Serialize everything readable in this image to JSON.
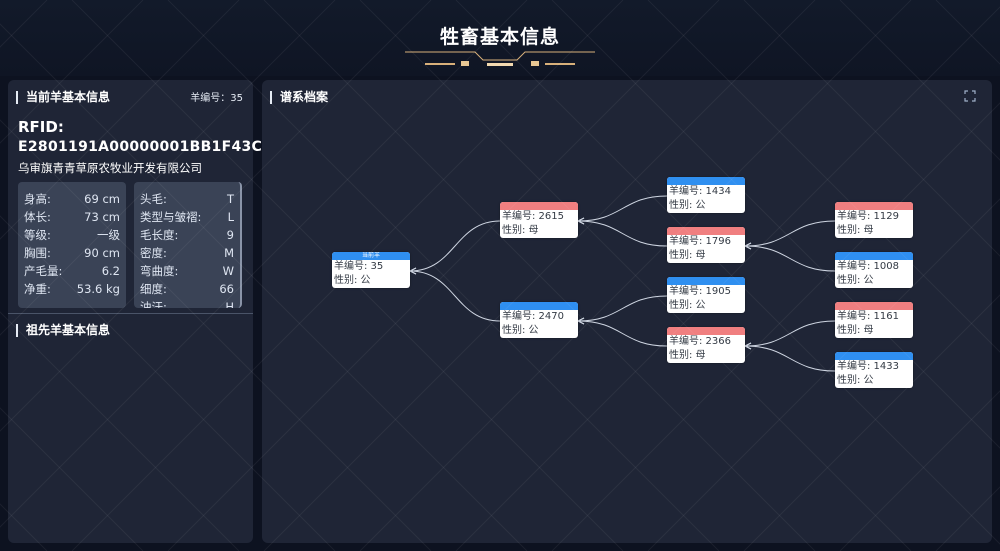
{
  "header": {
    "title": "牲畜基本信息"
  },
  "current_sheep": {
    "panel_title": "当前羊基本信息",
    "sheep_no_label": "羊编号：",
    "sheep_no": "35",
    "rfid_label": "RFID:",
    "rfid_value": "E2801191A00000001BB1F43C",
    "company": "乌审旗青青草原农牧业开发有限公司",
    "attrs_left": [
      {
        "k": "身高:",
        "v": "69 cm"
      },
      {
        "k": "体长:",
        "v": "73 cm"
      },
      {
        "k": "等级:",
        "v": "一级"
      },
      {
        "k": "胸围:",
        "v": "90 cm"
      },
      {
        "k": "产毛量:",
        "v": "6.2"
      },
      {
        "k": "净重:",
        "v": "53.6 kg"
      }
    ],
    "attrs_right": [
      {
        "k": "头毛:",
        "v": "T"
      },
      {
        "k": "类型与皱褶:",
        "v": "L"
      },
      {
        "k": "毛长度:",
        "v": "9"
      },
      {
        "k": "密度:",
        "v": "M"
      },
      {
        "k": "弯曲度:",
        "v": "W"
      },
      {
        "k": "细度:",
        "v": "66"
      },
      {
        "k": "油汗:",
        "v": "H"
      }
    ]
  },
  "ancestor": {
    "panel_title": "祖先羊基本信息"
  },
  "pedigree": {
    "panel_title": "谱系档案",
    "no_label": "羊编号: ",
    "sex_label": "性别: ",
    "current_tag": "当前羊",
    "nodes": [
      {
        "id": "n35",
        "no": "35",
        "sex": "公",
        "color": "blue",
        "tag": "当前羊"
      },
      {
        "id": "n2615",
        "no": "2615",
        "sex": "母",
        "color": "pink",
        "tag": ""
      },
      {
        "id": "n2470",
        "no": "2470",
        "sex": "公",
        "color": "blue",
        "tag": ""
      },
      {
        "id": "n1434",
        "no": "1434",
        "sex": "公",
        "color": "blue",
        "tag": ""
      },
      {
        "id": "n1796",
        "no": "1796",
        "sex": "母",
        "color": "pink",
        "tag": ""
      },
      {
        "id": "n1905",
        "no": "1905",
        "sex": "公",
        "color": "blue",
        "tag": ""
      },
      {
        "id": "n2366",
        "no": "2366",
        "sex": "母",
        "color": "pink",
        "tag": ""
      },
      {
        "id": "n1129",
        "no": "1129",
        "sex": "母",
        "color": "pink",
        "tag": ""
      },
      {
        "id": "n1008",
        "no": "1008",
        "sex": "公",
        "color": "blue",
        "tag": ""
      },
      {
        "id": "n1161",
        "no": "1161",
        "sex": "母",
        "color": "pink",
        "tag": ""
      },
      {
        "id": "n1433",
        "no": "1433",
        "sex": "公",
        "color": "blue",
        "tag": ""
      }
    ],
    "links": [
      [
        "n35",
        "n2615"
      ],
      [
        "n35",
        "n2470"
      ],
      [
        "n2615",
        "n1434"
      ],
      [
        "n2615",
        "n1796"
      ],
      [
        "n2470",
        "n1905"
      ],
      [
        "n2470",
        "n2366"
      ],
      [
        "n1796",
        "n1129"
      ],
      [
        "n1796",
        "n1008"
      ],
      [
        "n2366",
        "n1161"
      ],
      [
        "n2366",
        "n1433"
      ]
    ]
  },
  "colors": {
    "blue": "#2f8ff0",
    "pink": "#f07f80",
    "panel": "#1f2536",
    "link": "#cfd6e2"
  },
  "icons": {
    "expand": "fullscreen-icon"
  }
}
